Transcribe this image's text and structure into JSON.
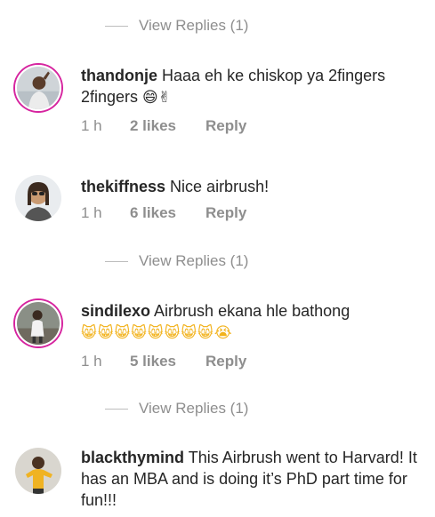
{
  "view_replies": [
    "View Replies (1)",
    "View Replies (1)",
    "View Replies (1)"
  ],
  "comments": [
    {
      "username": "thandonje",
      "text": "Haaa eh ke chiskop ya 2fingers",
      "emoji": "😄✌",
      "time": "1 h",
      "likes": "2 likes",
      "reply": "Reply"
    },
    {
      "username": "thekiffness",
      "text": "Nice airbrush!",
      "time": "1 h",
      "likes": "6 likes",
      "reply": "Reply"
    },
    {
      "username": "sindilexo",
      "text": "Airbrush ekana hle bathong",
      "emoji": "😸😸😸😸😸😸😸😸😭",
      "time": "1 h",
      "likes": "5 likes",
      "reply": "Reply"
    },
    {
      "username": "blackthymind",
      "text": "This Airbrush went to Harvard! It has an MBA and is doing it’s PhD part time for fun!!!"
    }
  ]
}
